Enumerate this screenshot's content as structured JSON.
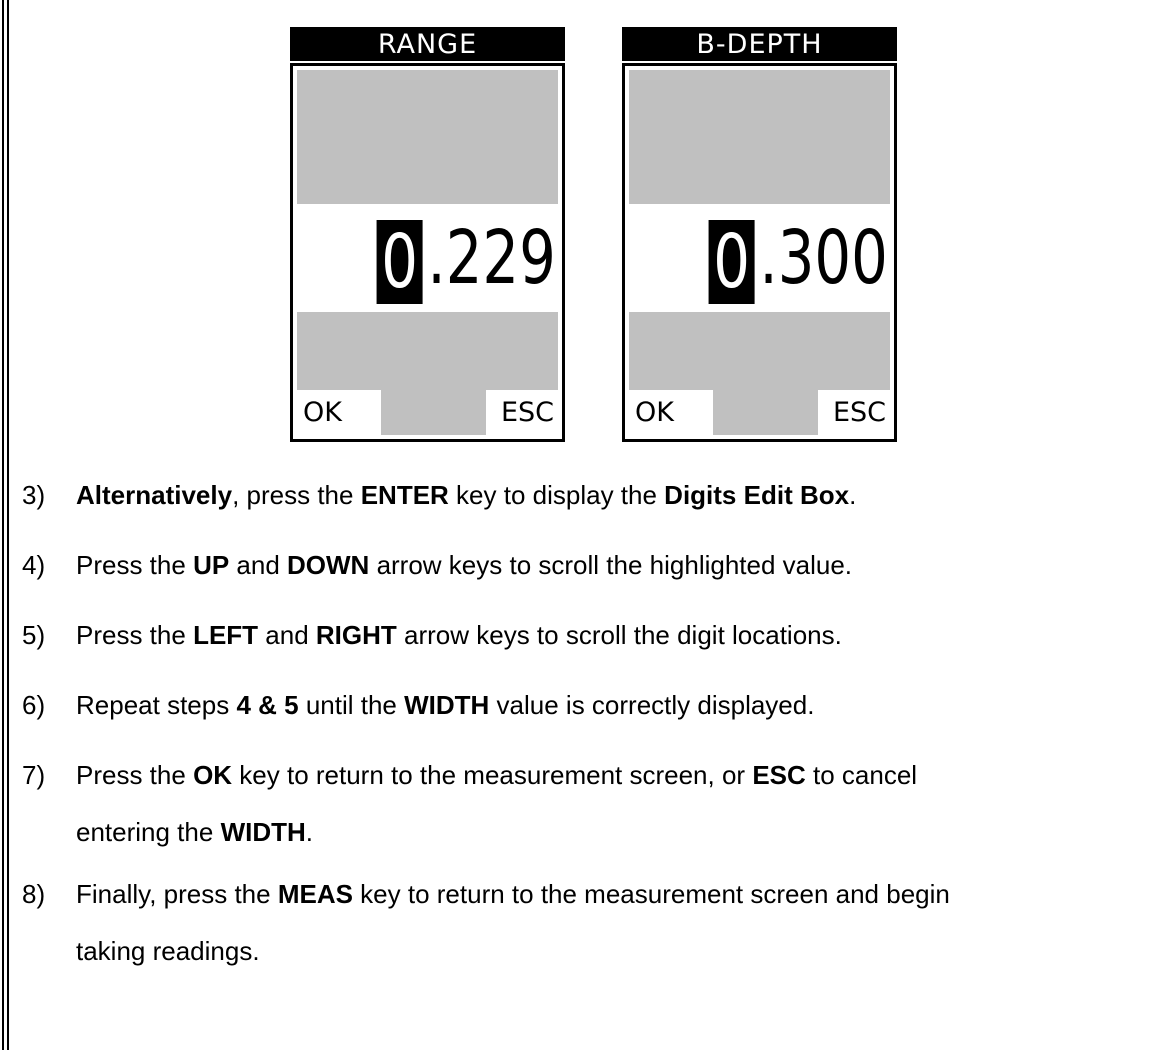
{
  "screens": [
    {
      "title": "RANGE",
      "digit": "0",
      "rest": ".229",
      "ok": "OK",
      "esc": "ESC"
    },
    {
      "title": "B-DEPTH",
      "digit": "0",
      "rest": ".300",
      "ok": "OK",
      "esc": "ESC"
    }
  ],
  "steps": {
    "s3": {
      "num": "3)",
      "b1": "Alternatively",
      "t1": ", press the ",
      "b2": "ENTER",
      "t2": " key to display the ",
      "b3": "Digits Edit Box",
      "t3": "."
    },
    "s4": {
      "num": "4)",
      "t1": "Press the ",
      "b1": "UP",
      "t2": " and ",
      "b2": "DOWN",
      "t3": " arrow keys to scroll the highlighted value."
    },
    "s5": {
      "num": "5)",
      "t1": "Press the ",
      "b1": "LEFT",
      "t2": " and ",
      "b2": "RIGHT",
      "t3": " arrow keys to scroll the digit locations."
    },
    "s6": {
      "num": "6)",
      "t1": "Repeat steps ",
      "b1": "4 & 5",
      "t2": " until the ",
      "b2": "WIDTH",
      "t3": " value is correctly displayed."
    },
    "s7": {
      "num": "7)",
      "t1": "Press the ",
      "b1": "OK",
      "t2": " key to return to the measurement screen, or ",
      "b2": "ESC",
      "t3": " to cancel",
      "t4": "entering the ",
      "b3": "WIDTH",
      "t5": "."
    },
    "s8": {
      "num": "8)",
      "t1": "Finally, press the ",
      "b1": "MEAS",
      "t2": " key to return to the measurement screen and begin",
      "t3": "taking readings."
    }
  }
}
